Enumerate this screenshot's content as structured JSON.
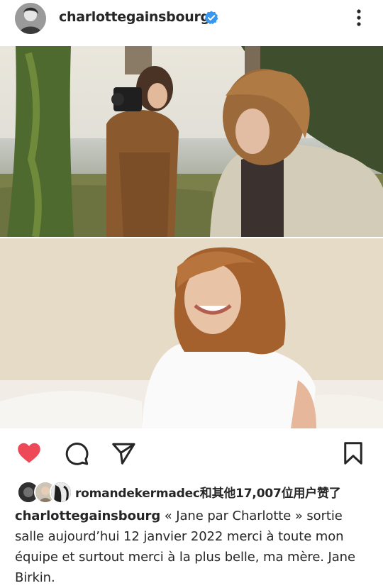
{
  "post": {
    "username": "charlottegainsbourg",
    "verified": true,
    "likes_text": "romandekermadec和其他17,007位用户赞了",
    "caption_username": "charlottegainsbourg",
    "caption_text": "« Jane par Charlotte » sortie salle aujourd’hui 12 janvier 2022 merci à toute mon équipe et surtout merci à la plus belle, ma mère. Jane Birkin."
  },
  "icons": {
    "verified": "verified-badge-icon",
    "more": "more-vertical-icon",
    "like": "heart-icon",
    "comment": "comment-icon",
    "share": "send-icon",
    "save": "bookmark-icon"
  },
  "colors": {
    "like": "#ed4956",
    "verified": "#3897f0",
    "text": "#262626"
  }
}
